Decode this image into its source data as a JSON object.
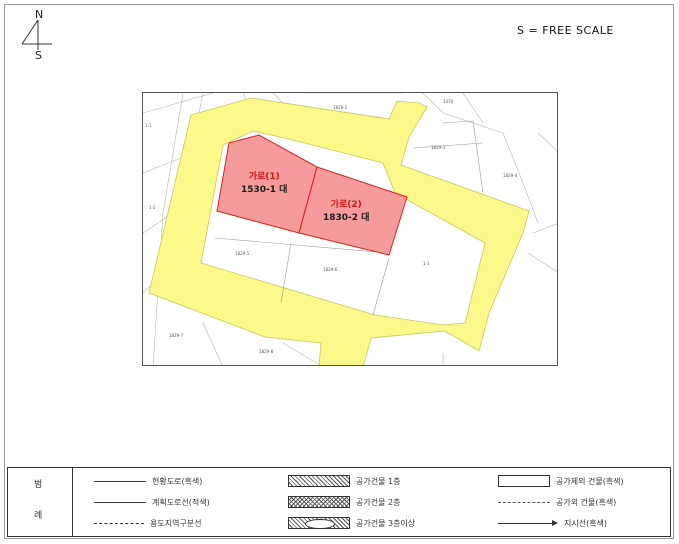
{
  "compass": {
    "north": "N",
    "south": "S"
  },
  "scale_label": "S = FREE SCALE",
  "lots": [
    {
      "title": "가로(1)",
      "number": "1530-1 대"
    },
    {
      "title": "가로(2)",
      "number": "1830-2 대"
    }
  ],
  "legend": {
    "heading_top": "범",
    "heading_bottom": "례",
    "items": [
      {
        "symbol": "line",
        "label": "현황도로(흑색)"
      },
      {
        "symbol": "hatch",
        "label": "공가건물 1층"
      },
      {
        "symbol": "box",
        "label": "공가제외 건물(흑색)"
      },
      {
        "symbol": "line",
        "label": "계획도로선(적색)"
      },
      {
        "symbol": "cross",
        "label": "공가건물 2층"
      },
      {
        "symbol": "dash",
        "label": "공가외 건물(흑색)"
      },
      {
        "symbol": "dashdot",
        "label": "용도지역구분선"
      },
      {
        "symbol": "oval",
        "label": "공가건물 3층이상"
      },
      {
        "symbol": "arrow",
        "label": "지시선(흑색)"
      }
    ]
  },
  "colors": {
    "road_fill": "#fbf98a",
    "target_lot_fill": "#f58a8a",
    "target_lot_border": "#dd2222"
  }
}
